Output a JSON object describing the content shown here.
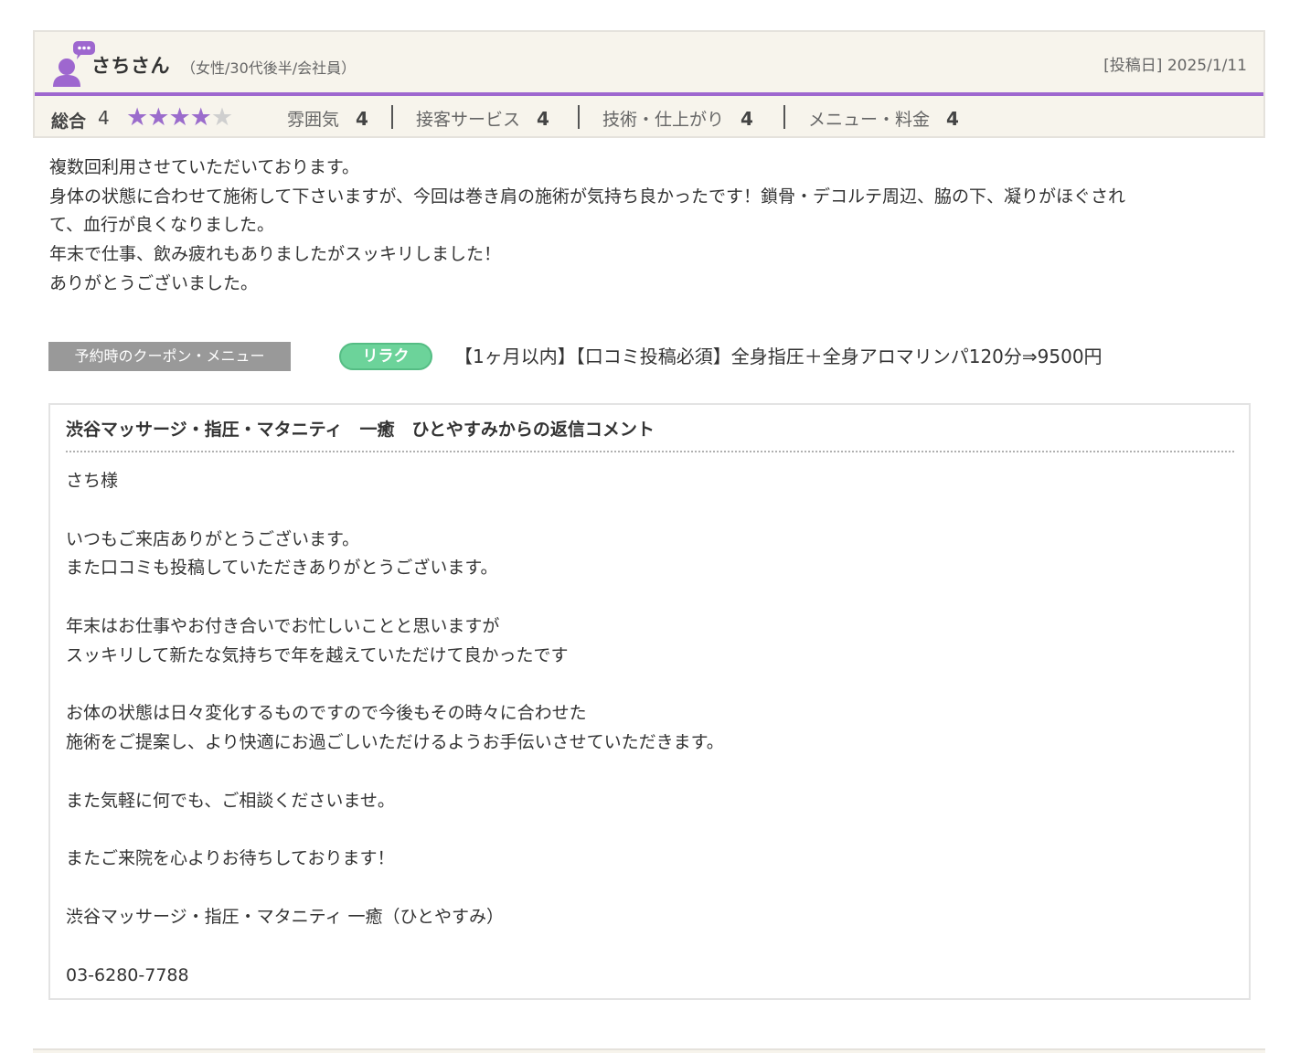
{
  "review": {
    "reviewer_name": "さちさん",
    "reviewer_profile": "（女性/30代後半/会社員）",
    "post_date": "[投稿日] 2025/1/11",
    "overall_label": "総合",
    "overall_score": "4",
    "star_rating": 4,
    "star_max": 5,
    "colors": {
      "accent": "#9e67cf",
      "star": "#9b6ccc",
      "header_bg": "#f7f4ec"
    },
    "sub_ratings": [
      {
        "label": "雰囲気",
        "value": "4"
      },
      {
        "label": "接客サービス",
        "value": "4"
      },
      {
        "label": "技術・仕上がり",
        "value": "4"
      },
      {
        "label": "メニュー・料金",
        "value": "4"
      }
    ],
    "body_lines": [
      "複数回利用させていただいております。",
      "身体の状態に合わせて施術して下さいますが、今回は巻き肩の施術が気持ち良かったです！鎖骨・デコルテ周辺、脇の下、凝りがほぐされ",
      "て、血行が良くなりました。",
      "年末で仕事、飲み疲れもありましたがスッキリしました！",
      "ありがとうございました。"
    ]
  },
  "coupon": {
    "label": "予約時のクーポン・メニュー",
    "badge": "リラク",
    "badge_color": "#6cd39a",
    "text": "【1ヶ月以内】【口コミ投稿必須】全身指圧＋全身アロマリンパ120分⇒9500円"
  },
  "reply": {
    "title": "渋谷マッサージ・指圧・マタニティ　一癒　ひとやすみからの返信コメント",
    "lines": [
      "さち様",
      "",
      "いつもご来店ありがとうございます。",
      "また口コミも投稿していただきありがとうございます。",
      "",
      "年末はお仕事やお付き合いでお忙しいことと思いますが",
      "スッキリして新たな気持ちで年を越えていただけて良かったです",
      "",
      "お体の状態は日々変化するものですので今後もその時々に合わせた",
      "施術をご提案し、より快適にお過ごしいただけるようお手伝いさせていただきます。",
      "",
      "また気軽に何でも、ご相談くださいませ。",
      "",
      "またご来院を心よりお待ちしております！",
      "",
      "渋谷マッサージ・指圧・マタニティ 一癒（ひとやすみ）",
      "",
      "03-6280-7788"
    ]
  }
}
